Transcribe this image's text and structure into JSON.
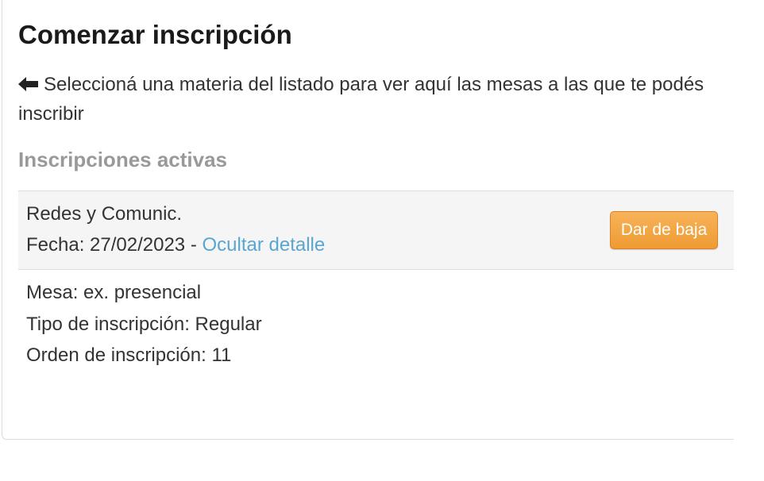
{
  "page_title": "Comenzar inscripción",
  "instructions": {
    "icon": "arrow-left-icon",
    "text": "Seleccioná una materia del listado para ver aquí las mesas a las que te podés inscribir"
  },
  "active_section": {
    "title": "Inscripciones activas"
  },
  "enrollment": {
    "subject": "Redes y Comunic.",
    "date_prefix": "Fecha: 27/02/2023 - ",
    "toggle_label": "Ocultar detalle",
    "unsubscribe_label": "Dar de baja",
    "details": {
      "mesa": "Mesa: ex. presencial",
      "tipo": "Tipo de inscripción: Regular",
      "orden": "Orden de inscripción: 11"
    }
  },
  "colors": {
    "link": "#5aa6d0",
    "button": "#ef9b32",
    "section_title": "#999999"
  }
}
